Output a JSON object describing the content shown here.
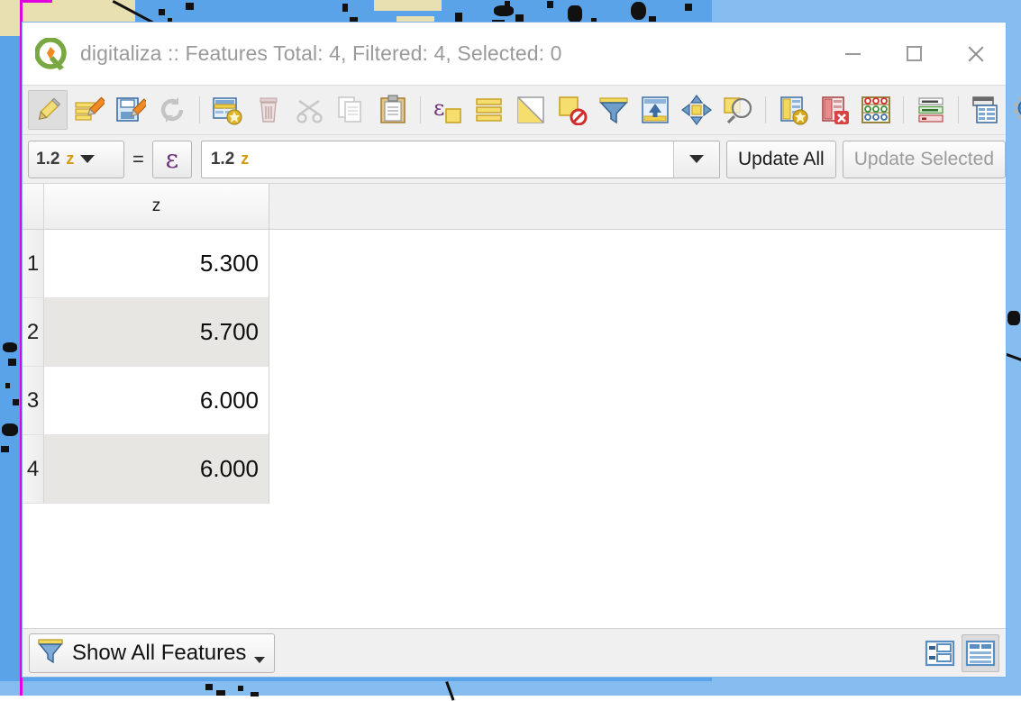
{
  "window": {
    "title": "digitaliza :: Features Total: 4, Filtered: 4, Selected: 0",
    "logo_name": "qgis-logo",
    "controls": {
      "minimize": "–",
      "maximize": "□",
      "close": "✕"
    }
  },
  "toolbar": {
    "groups": [
      {
        "buttons": [
          {
            "name": "toggle-editing-icon",
            "tooltip": "Toggle editing mode",
            "pressed": true
          },
          {
            "name": "save-edits-icon",
            "tooltip": "Save edits",
            "pressed": false
          },
          {
            "name": "save-layer-edits-icon",
            "tooltip": "Save layer edits",
            "pressed": false
          },
          {
            "name": "reload-table-icon",
            "tooltip": "Reload the table",
            "pressed": false
          }
        ]
      },
      {
        "buttons": [
          {
            "name": "add-feature-icon",
            "tooltip": "Add feature",
            "pressed": false
          },
          {
            "name": "delete-selected-icon",
            "tooltip": "Delete selected features",
            "pressed": false
          },
          {
            "name": "cut-features-icon",
            "tooltip": "Cut selected features to clipboard",
            "pressed": false
          },
          {
            "name": "copy-features-icon",
            "tooltip": "Copy selected features to clipboard",
            "pressed": false
          },
          {
            "name": "paste-features-icon",
            "tooltip": "Paste features from clipboard",
            "pressed": false
          }
        ]
      },
      {
        "buttons": [
          {
            "name": "select-by-expression-icon",
            "tooltip": "Select features using an expression",
            "pressed": false
          },
          {
            "name": "select-all-icon",
            "tooltip": "Select all features",
            "pressed": false
          },
          {
            "name": "invert-selection-icon",
            "tooltip": "Invert selection",
            "pressed": false
          },
          {
            "name": "deselect-all-icon",
            "tooltip": "Deselect all features",
            "pressed": false
          },
          {
            "name": "filter-selection-icon",
            "tooltip": "Filter / select features",
            "pressed": false
          },
          {
            "name": "move-selection-to-top-icon",
            "tooltip": "Move selection to top",
            "pressed": false
          },
          {
            "name": "pan-map-to-selection-icon",
            "tooltip": "Pan map to selected rows",
            "pressed": false
          },
          {
            "name": "zoom-map-to-selection-icon",
            "tooltip": "Zoom map to selected rows",
            "pressed": false
          }
        ]
      },
      {
        "buttons": [
          {
            "name": "new-field-icon",
            "tooltip": "New field",
            "pressed": false
          },
          {
            "name": "delete-field-icon",
            "tooltip": "Delete field",
            "pressed": false
          },
          {
            "name": "open-field-calculator-icon",
            "tooltip": "Open field calculator",
            "pressed": false
          }
        ]
      },
      {
        "buttons": [
          {
            "name": "conditional-formatting-icon",
            "tooltip": "Conditional formatting",
            "pressed": false
          }
        ]
      },
      {
        "buttons": [
          {
            "name": "organize-columns-icon",
            "tooltip": "Organize columns",
            "pressed": false
          },
          {
            "name": "actions-icon",
            "tooltip": "Actions",
            "pressed": false
          }
        ]
      }
    ]
  },
  "expression_bar": {
    "field_selector": {
      "type_glyph": "1.2",
      "field_name": "z",
      "caret": "▼"
    },
    "equals": "=",
    "expression_button_glyph": "ε",
    "expression_input": {
      "type_glyph": "1.2",
      "value": "z",
      "placeholder": ""
    },
    "update_all_label": "Update All",
    "update_selected_label": "Update Selected",
    "update_selected_disabled": true
  },
  "table": {
    "columns": [
      "z"
    ],
    "rows": [
      {
        "num": "1",
        "z": "5.300"
      },
      {
        "num": "2",
        "z": "5.700"
      },
      {
        "num": "3",
        "z": "6.000"
      },
      {
        "num": "4",
        "z": "6.000"
      }
    ]
  },
  "status_bar": {
    "filter_label": "Show All Features",
    "filter_icon": "funnel-icon",
    "view_buttons": [
      {
        "name": "form-view-button",
        "active": false
      },
      {
        "name": "table-view-button",
        "active": true
      }
    ]
  },
  "colors": {
    "map_water": "#5ba3e8",
    "map_water_light": "#86bdf0",
    "map_land": "#e8e0b0",
    "selection_magenta": "#e000e0",
    "window_border": "#7eb4ea",
    "chrome": "#f0f0f0",
    "row_alt": "#e7e6e3",
    "title_text": "#9a9a9a"
  }
}
